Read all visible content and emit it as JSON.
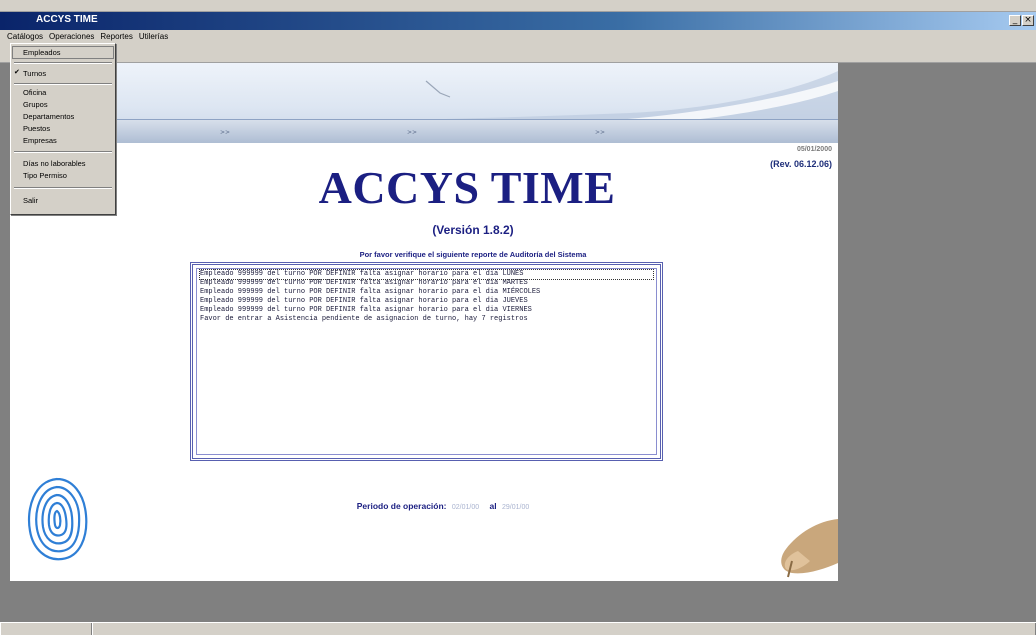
{
  "window": {
    "title": "ACCYS TIME",
    "buttons": [
      "_",
      "×"
    ]
  },
  "menubar": {
    "items": [
      "Catálogos",
      "Operaciones",
      "Reportes",
      "Utilerías"
    ]
  },
  "dropdown": {
    "items": {
      "empleados": "Empleados",
      "turnos": "Turnos",
      "oficina": "Oficina",
      "grupos": "Grupos",
      "departamentos": "Departamentos",
      "puestos": "Puestos",
      "empresas": "Empresas",
      "dias_no_laborables": "Días no laborables",
      "tipo_permiso": "Tipo Permiso",
      "salir": "Salir"
    },
    "checked": "Turnos"
  },
  "page": {
    "date": "05/01/2000",
    "revision": "(Rev. 06.12.06)",
    "app_title": "ACCYS TIME",
    "version": "(Versión 1.8.2)",
    "audit_caption": "Por favor verifique el siguiente reporte de Auditoría del Sistema",
    "audit_lines": [
      "Empleado 999999 del turno POR DEFINIR falta asignar horario para el dia LUNES",
      "Empleado 999999 del turno POR DEFINIR falta asignar horario para el dia MARTES",
      "Empleado 999999 del turno POR DEFINIR falta asignar horario para el dia MIÉRCOLES",
      "Empleado 999999 del turno POR DEFINIR falta asignar horario para el dia JUEVES",
      "Empleado 999999 del turno POR DEFINIR falta asignar horario para el dia VIERNES",
      "Favor de entrar a Asistencia pendiente de asignacion de turno, hay 7 registros"
    ],
    "period_label": "Periodo de operación:",
    "period_from": "02/01/00",
    "period_sep": "al",
    "period_to": "29/01/00"
  },
  "colors": {
    "title_blue": "#1b1f82",
    "titlebar": "#0a246a",
    "chrome": "#d4d0c8",
    "mdi_background": "#808080"
  }
}
